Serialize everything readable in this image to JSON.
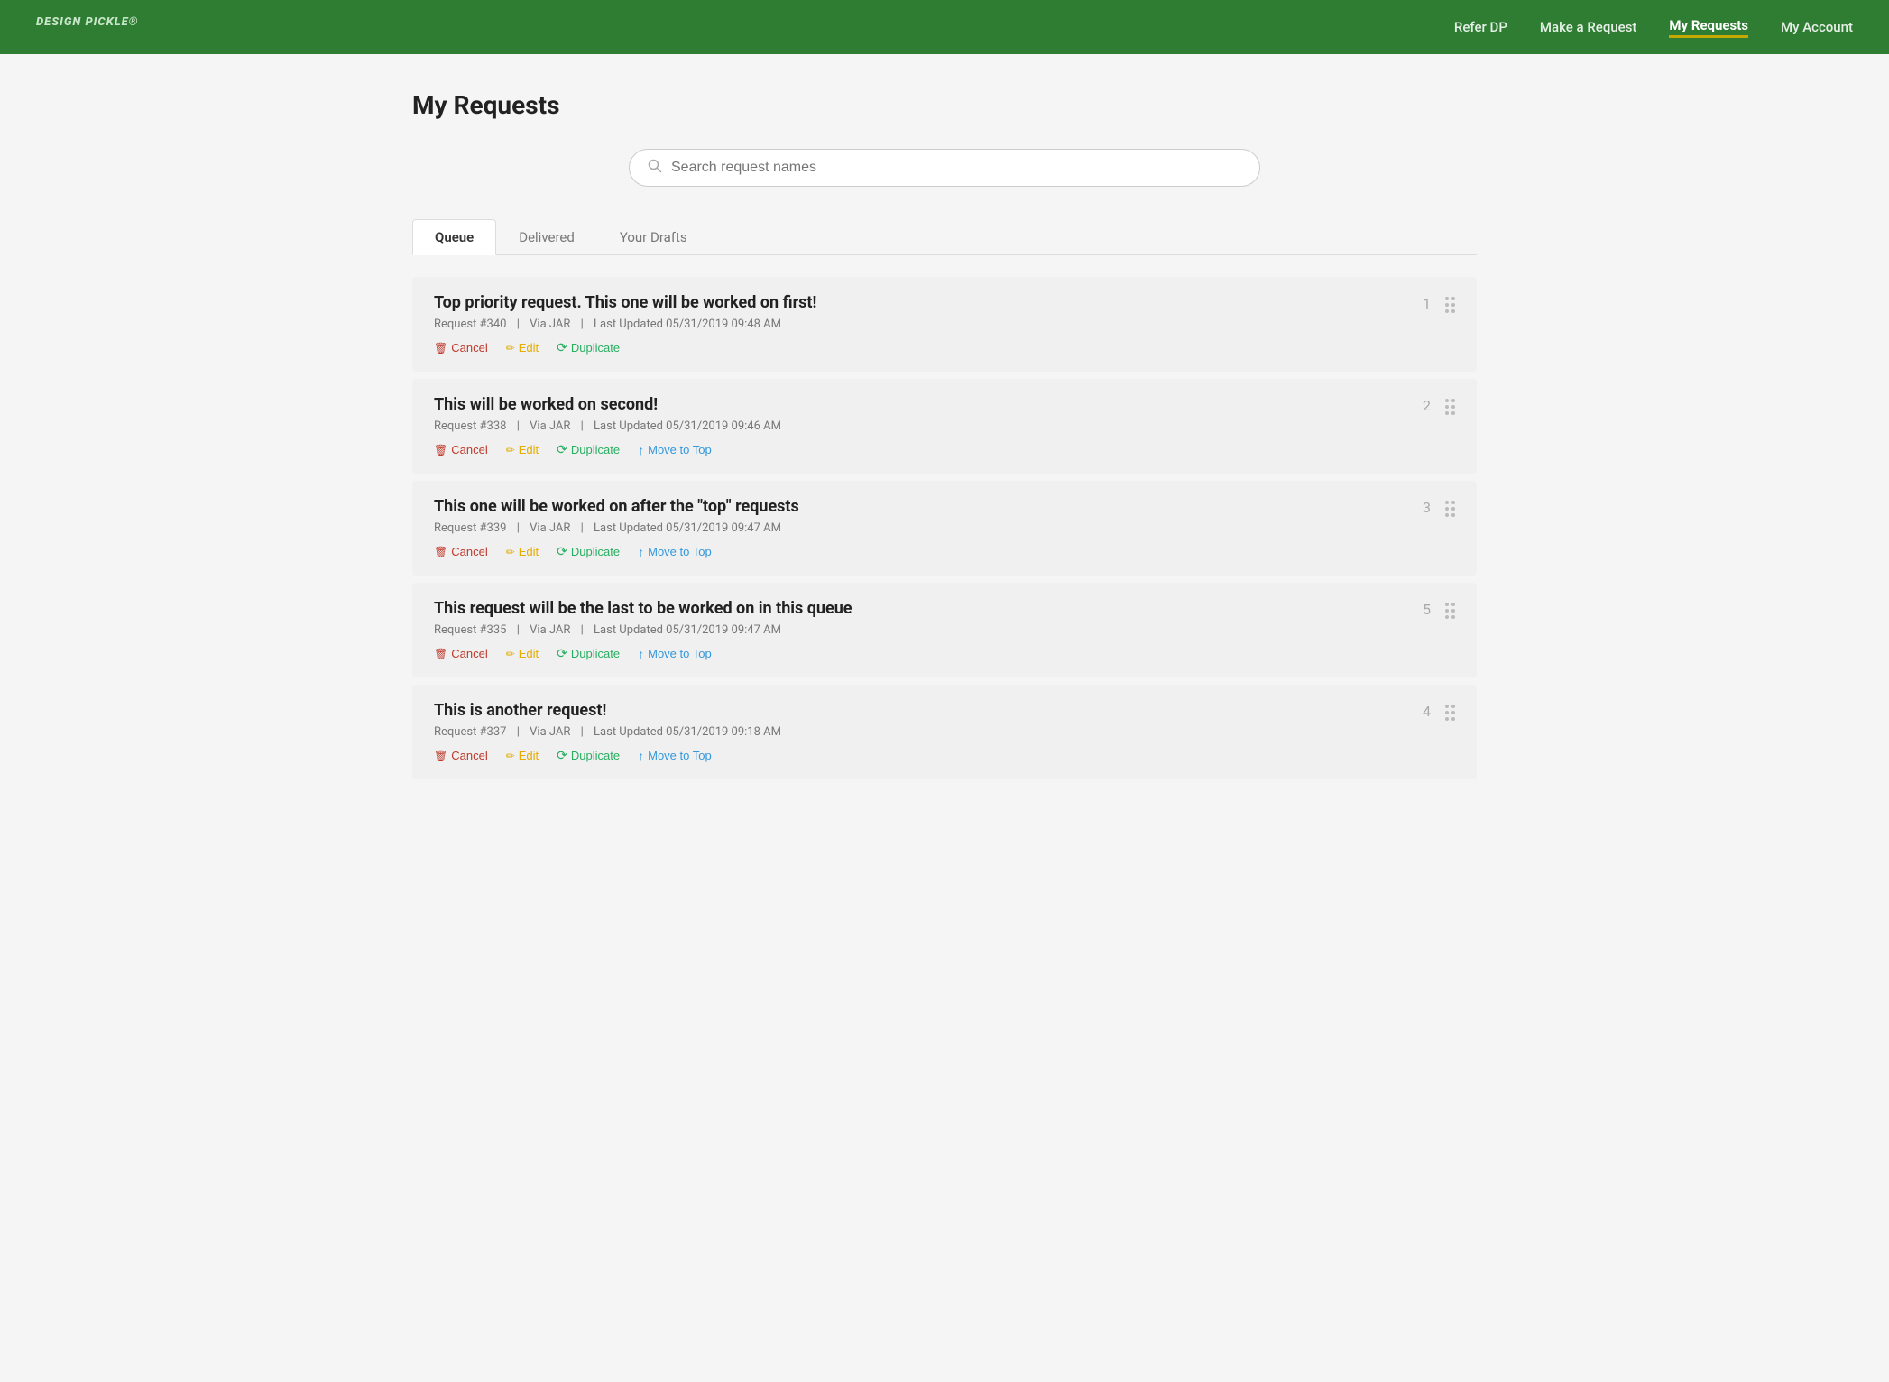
{
  "brand": {
    "name": "DESIGN PICKLE",
    "trademark": "®"
  },
  "nav": {
    "links": [
      {
        "label": "Refer DP",
        "active": false
      },
      {
        "label": "Make a Request",
        "active": false
      },
      {
        "label": "My Requests",
        "active": true
      },
      {
        "label": "My Account",
        "active": false
      }
    ]
  },
  "page": {
    "title": "My Requests"
  },
  "search": {
    "placeholder": "Search request names"
  },
  "tabs": [
    {
      "label": "Queue",
      "active": true
    },
    {
      "label": "Delivered",
      "active": false
    },
    {
      "label": "Your Drafts",
      "active": false
    }
  ],
  "requests": [
    {
      "id": 0,
      "title": "Top priority request. This one will be worked on first!",
      "request_num": "Request #340",
      "via": "Via JAR",
      "last_updated": "Last Updated 05/31/2019 09:48 AM",
      "queue_position": "1",
      "show_move_to_top": false,
      "actions": [
        "Cancel",
        "Edit",
        "Duplicate"
      ]
    },
    {
      "id": 1,
      "title": "This will be worked on second!",
      "request_num": "Request #338",
      "via": "Via JAR",
      "last_updated": "Last Updated 05/31/2019 09:46 AM",
      "queue_position": "2",
      "show_move_to_top": true,
      "actions": [
        "Cancel",
        "Edit",
        "Duplicate",
        "Move to Top"
      ]
    },
    {
      "id": 2,
      "title": "This one will be worked on after the \"top\" requests",
      "request_num": "Request #339",
      "via": "Via JAR",
      "last_updated": "Last Updated 05/31/2019 09:47 AM",
      "queue_position": "3",
      "show_move_to_top": true,
      "actions": [
        "Cancel",
        "Edit",
        "Duplicate",
        "Move to Top"
      ]
    },
    {
      "id": 3,
      "title": "This request will be the last to be worked on in this queue",
      "request_num": "Request #335",
      "via": "Via JAR",
      "last_updated": "Last Updated 05/31/2019 09:47 AM",
      "queue_position": "5",
      "show_move_to_top": true,
      "actions": [
        "Cancel",
        "Edit",
        "Duplicate",
        "Move to Top"
      ]
    },
    {
      "id": 4,
      "title": "This is another request!",
      "request_num": "Request #337",
      "via": "Via JAR",
      "last_updated": "Last Updated 05/31/2019 09:18 AM",
      "queue_position": "4",
      "show_move_to_top": true,
      "actions": [
        "Cancel",
        "Edit",
        "Duplicate",
        "Move to Top"
      ]
    }
  ],
  "labels": {
    "cancel": "Cancel",
    "edit": "Edit",
    "duplicate": "Duplicate",
    "move_to_top": "Move to Top",
    "separator": "|"
  }
}
